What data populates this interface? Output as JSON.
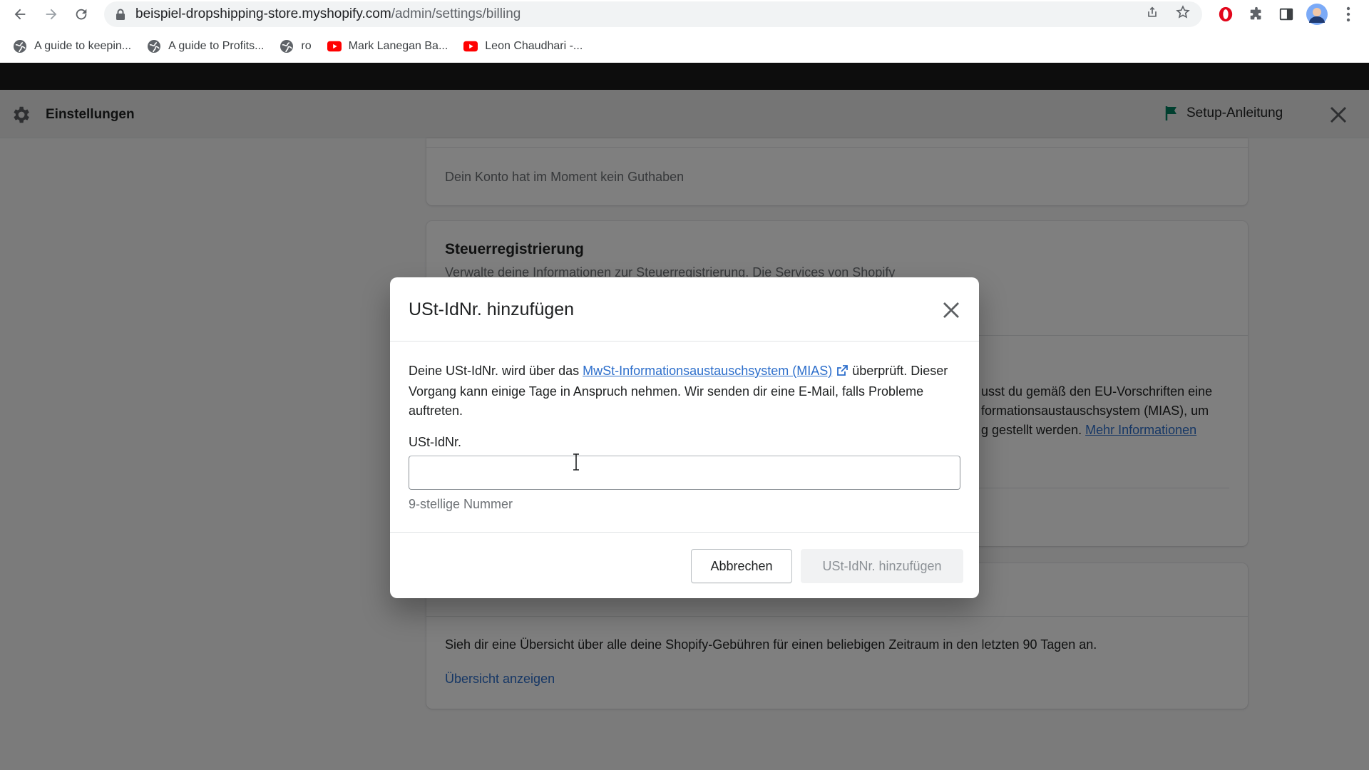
{
  "browser": {
    "url_host": "beispiel-dropshipping-store.myshopify.com",
    "url_path": "/admin/settings/billing",
    "bookmarks": [
      {
        "label": "A guide to keepin...",
        "icon": "globe-icon"
      },
      {
        "label": "A guide to Profits...",
        "icon": "globe-icon"
      },
      {
        "label": "ro",
        "icon": "globe-icon"
      },
      {
        "label": "Mark Lanegan Ba...",
        "icon": "youtube-icon"
      },
      {
        "label": "Leon Chaudhari -...",
        "icon": "youtube-icon"
      }
    ]
  },
  "settings": {
    "title": "Einstellungen",
    "setup_label": "Setup-Anleitung"
  },
  "background": {
    "credit_text": "Dein Konto hat im Moment kein Guthaben",
    "tax_heading": "Steuerregistrierung",
    "tax_sub": "Verwalte deine Informationen zur Steuerregistrierung. Die Services von Shopify",
    "tax_para_l1": "usst du gemäß den EU-Vorschriften eine",
    "tax_para_l2": "formationsaustauschsystem (MIAS), um",
    "tax_para_l3": "g gestellt werden.",
    "tax_more_link": "Mehr Informationen",
    "fees_text": "Sieh dir eine Übersicht über alle deine Shopify-Gebühren für einen beliebigen Zeitraum in den letzten 90 Tagen an.",
    "fees_link": "Übersicht anzeigen"
  },
  "modal": {
    "title": "USt-IdNr. hinzufügen",
    "desc_before": "Deine USt-IdNr. wird über das ",
    "desc_link": "MwSt-Informationsaustauschsystem (MIAS)",
    "desc_after": "überprüft. Dieser Vorgang kann einige Tage in Anspruch nehmen. Wir senden dir eine E-Mail, falls Probleme auftreten.",
    "field_label": "USt-IdNr.",
    "field_value": "",
    "help_text": "9-stellige Nummer",
    "cancel_label": "Abbrechen",
    "submit_label": "USt-IdNr. hinzufügen"
  },
  "colors": {
    "link": "#2c6ecb",
    "setup_flag": "#007f5f",
    "opera": "#e2061b",
    "youtube": "#ff0000"
  }
}
